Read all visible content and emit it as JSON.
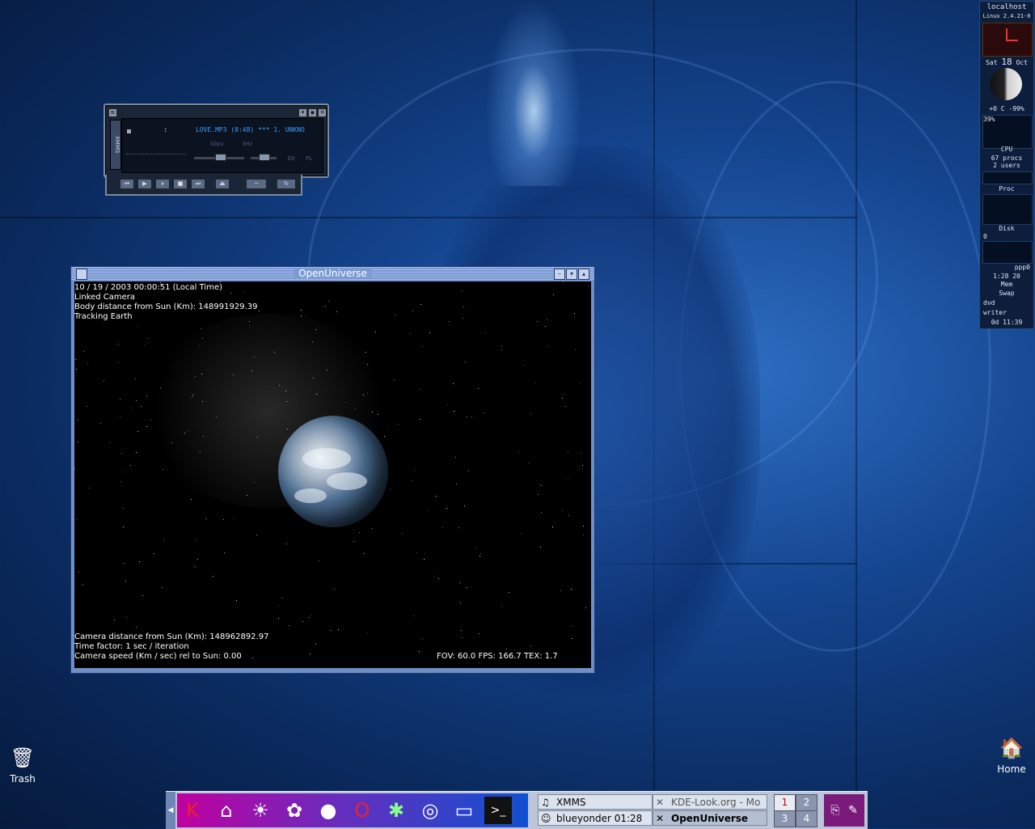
{
  "desktop": {
    "icons": [
      {
        "label": "Trash",
        "icon": "trash-icon"
      },
      {
        "label": "Home",
        "icon": "home-icon"
      }
    ]
  },
  "xmms": {
    "side_label": "XMMS",
    "title": "LOVE.MP3 (8:48) *** 1. UNKNO",
    "time": ":",
    "kbps_label": "kbps",
    "khz_label": "kHz",
    "eq_label": "EQ",
    "pl_label": "PL"
  },
  "openuniverse": {
    "title": "OpenUniverse",
    "info_top": [
      "10 / 19 / 2003  00:00:51 (Local Time)",
      "Linked Camera",
      "Body distance from Sun (Km): 148991929.39",
      "Tracking Earth"
    ],
    "info_bottom": [
      "Camera distance from Sun (Km): 148962892.97",
      "Time factor: 1 sec / iteration",
      "Camera speed (Km / sec) rel to Sun: 0.00"
    ],
    "stats": "FOV: 60.0   FPS: 166.7  TEX: 1.7"
  },
  "gkrellm": {
    "hostname": "localhost",
    "kernel": "Linux 2.4.21-0",
    "date_day": "Sat",
    "date_num": "18",
    "date_month": "Oct",
    "temp": "+0  C  -99%",
    "cpu_pct": "39%",
    "cpu_label": "CPU",
    "procs": "67 procs",
    "users": "2 users",
    "proc_label": "Proc",
    "disk_label": "Disk",
    "disk_value": "0",
    "net_label": "ppp0",
    "net_time": "1:28 20",
    "mem_label": "Mem",
    "swap_label": "Swap",
    "fs1": "dvd",
    "fs2": "writer",
    "uptime": "0d 11:39"
  },
  "panel": {
    "launchers": [
      "k-menu-icon",
      "home-icon",
      "sun-cloud-icon",
      "network-icon",
      "globe-icon",
      "opera-icon",
      "star-icon",
      "xmms-icon",
      "monitor-icon",
      "terminal-icon"
    ],
    "tasks": [
      {
        "label": "XMMS",
        "icon": "xmms-task-icon"
      },
      {
        "label": "KDE-Look.org - Mo",
        "icon": "x-icon"
      },
      {
        "label": "blueyonder 01:28",
        "icon": "network-task-icon"
      },
      {
        "label": "OpenUniverse",
        "icon": "x-icon"
      }
    ],
    "pager": [
      "1",
      "2",
      "3",
      "4"
    ]
  },
  "colors": {
    "window_title": "#7c9bd4",
    "panel_bg": "#bcc6d8",
    "desktop_bg": "#14458f"
  }
}
